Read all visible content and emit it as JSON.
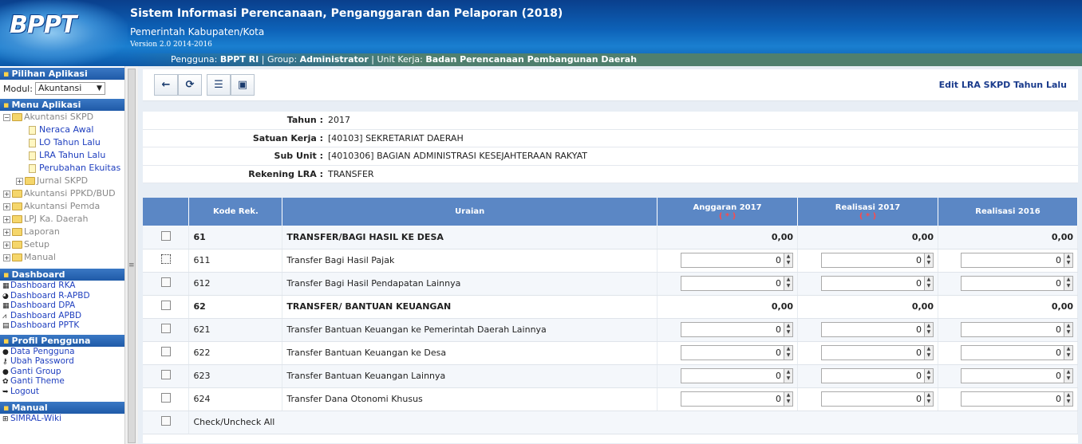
{
  "header": {
    "logo": "BPPT",
    "title": "Sistem Informasi Perencanaan, Penganggaran dan Pelaporan (2018)",
    "subtitle": "Pemerintah Kabupaten/Kota",
    "version": "Version 2.0 2014-2016",
    "user_label": "Pengguna:",
    "user": "BPPT RI",
    "group_label": "Group:",
    "group": "Administrator",
    "unit_label": "Unit Kerja:",
    "unit": "Badan Perencanaan Pembangunan Daerah"
  },
  "sidebar": {
    "pilihan_title": "Pilihan Aplikasi",
    "modul_label": "Modul:",
    "modul_value": "Akuntansi",
    "menu_title": "Menu Aplikasi",
    "tree": {
      "root": "Akuntansi SKPD",
      "children": [
        "Neraca Awal",
        "LO Tahun Lalu",
        "LRA Tahun Lalu",
        "Perubahan Ekuitas"
      ],
      "jurnal": "Jurnal SKPD",
      "others": [
        "Akuntansi PPKD/BUD",
        "Akuntansi Pemda",
        "LPJ Ka. Daerah",
        "Laporan",
        "Setup",
        "Manual"
      ]
    },
    "dashboard_title": "Dashboard",
    "dashboard_items": [
      "Dashboard RKA",
      "Dashboard R-APBD",
      "Dashboard DPA",
      "Dashboard APBD",
      "Dashboard PPTK"
    ],
    "profil_title": "Profil Pengguna",
    "profil_items": [
      "Data Pengguna",
      "Ubah Password",
      "Ganti Group",
      "Ganti Theme",
      "Logout"
    ],
    "manual_title": "Manual",
    "manual_items": [
      "SIMRAL-Wiki"
    ]
  },
  "toolbar": {
    "heading": "Edit LRA SKPD Tahun Lalu"
  },
  "info": {
    "tahun_label": "Tahun :",
    "tahun": "2017",
    "satuan_label": "Satuan Kerja :",
    "satuan": "[40103] SEKRETARIAT DAERAH",
    "subunit_label": "Sub Unit :",
    "subunit": "[4010306] BAGIAN ADMINISTRASI KESEJAHTERAAN RAKYAT",
    "rekening_label": "Rekening LRA :",
    "rekening": "TRANSFER"
  },
  "table": {
    "headers": {
      "kode": "Kode Rek.",
      "uraian": "Uraian",
      "anggaran": "Anggaran 2017",
      "realisasi": "Realisasi 2017",
      "realisasi_prev": "Realisasi 2016",
      "required_mark": "( * )"
    },
    "rows": [
      {
        "kode": "61",
        "uraian": "TRANSFER/BAGI HASIL KE DESA",
        "a": "0,00",
        "r": "0,00",
        "p": "0,00"
      },
      {
        "kode": "611",
        "uraian": "Transfer Bagi Hasil Pajak",
        "a": "0",
        "r": "0",
        "p": "0"
      },
      {
        "kode": "612",
        "uraian": "Transfer Bagi Hasil Pendapatan Lainnya",
        "a": "0",
        "r": "0",
        "p": "0"
      },
      {
        "kode": "62",
        "uraian": "TRANSFER/ BANTUAN KEUANGAN",
        "a": "0,00",
        "r": "0,00",
        "p": "0,00"
      },
      {
        "kode": "621",
        "uraian": "Transfer Bantuan Keuangan ke Pemerintah Daerah Lainnya",
        "a": "0",
        "r": "0",
        "p": "0"
      },
      {
        "kode": "622",
        "uraian": "Transfer Bantuan Keuangan ke Desa",
        "a": "0",
        "r": "0",
        "p": "0"
      },
      {
        "kode": "623",
        "uraian": "Transfer Bantuan Keuangan Lainnya",
        "a": "0",
        "r": "0",
        "p": "0"
      },
      {
        "kode": "624",
        "uraian": "Transfer Dana Otonomi Khusus",
        "a": "0",
        "r": "0",
        "p": "0"
      }
    ],
    "check_all": "Check/Uncheck All"
  }
}
